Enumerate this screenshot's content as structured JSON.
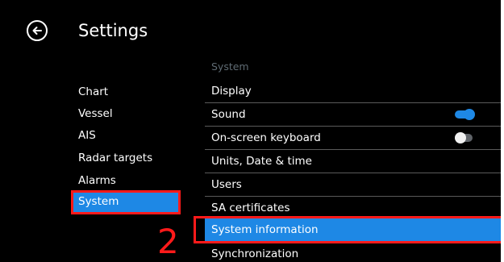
{
  "header": {
    "title": "Settings",
    "back_icon": "back-arrow-circle-icon"
  },
  "categories": [
    {
      "label": "Chart",
      "selected": false
    },
    {
      "label": "Vessel",
      "selected": false
    },
    {
      "label": "AIS",
      "selected": false
    },
    {
      "label": "Radar targets",
      "selected": false
    },
    {
      "label": "Alarms",
      "selected": false
    },
    {
      "label": "System",
      "selected": true
    }
  ],
  "section_header": "System",
  "rows": [
    {
      "label": "Display"
    },
    {
      "label": "Sound",
      "toggle": "on"
    },
    {
      "label": "On-screen keyboard",
      "toggle": "off"
    },
    {
      "label": "Units, Date & time"
    },
    {
      "label": "Users"
    },
    {
      "label": "SA certificates"
    },
    {
      "label": "System information",
      "selected": true
    },
    {
      "label": "Synchronization"
    }
  ],
  "annotation": {
    "step_number": "2"
  },
  "colors": {
    "accent": "#1e88e5",
    "highlight_outline": "#ff1a1a",
    "background": "#000000"
  }
}
